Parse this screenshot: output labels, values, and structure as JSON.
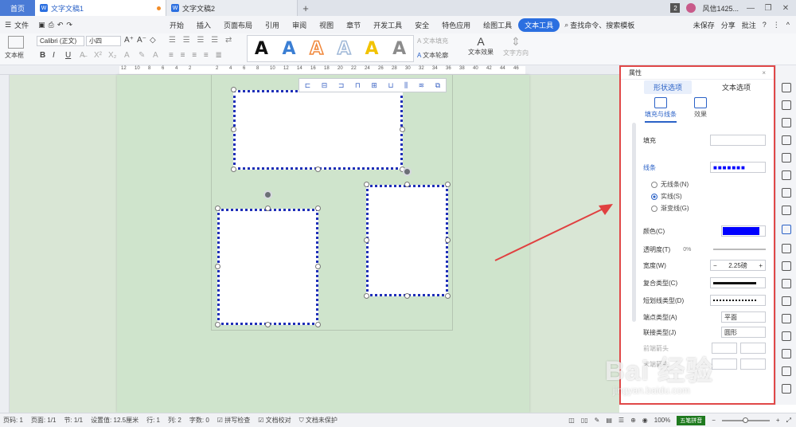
{
  "tabs": {
    "home": "首页",
    "doc1": "文字文稿1",
    "doc2": "文字文稿2",
    "plus": "+",
    "badge": "2",
    "user": "风信1425..."
  },
  "menu": {
    "file": "文件",
    "items": [
      "开始",
      "插入",
      "页面布局",
      "引用",
      "审阅",
      "视图",
      "章节",
      "开发工具",
      "安全",
      "特色应用",
      "绘图工具"
    ],
    "active": "文本工具",
    "search": "查找命令、搜索模板",
    "unsaved": "未保存",
    "share": "分享",
    "comment": "批注"
  },
  "ribbon": {
    "textbox": "文本框",
    "font_name": "Calibri (正文)",
    "font_size": "小四",
    "bold": "B",
    "italic": "I",
    "underline": "U",
    "style_letters": [
      "A",
      "A",
      "A",
      "A",
      "A",
      "A"
    ],
    "style_colors": [
      "#111111",
      "#3b7fd4",
      "#f0873a",
      "#9fb8d8",
      "#f2c300",
      "#8c8c8c"
    ],
    "text_fill": "文本填充",
    "text_outline": "文本轮廓",
    "text_effect": "文本效果",
    "text_direction": "文字方向"
  },
  "ruler": [
    "12",
    "10",
    "8",
    "6",
    "4",
    "2",
    "",
    "2",
    "4",
    "6",
    "8",
    "10",
    "12",
    "14",
    "16",
    "18",
    "20",
    "22",
    "24",
    "26",
    "28",
    "30",
    "32",
    "34",
    "36",
    "38",
    "40",
    "42",
    "44",
    "46",
    "48"
  ],
  "panel": {
    "title": "属性",
    "close": "×",
    "tab_shape": "形状选项",
    "tab_text": "文本选项",
    "sub_fill": "填充与线条",
    "sub_effect": "效果",
    "fill": "填充",
    "line": "线条",
    "no_line": "无线条(N)",
    "solid_line": "实线(S)",
    "gradient_line": "渐变线(G)",
    "color": "颜色(C)",
    "color_value": "#0000ff",
    "transparency": "透明度(T)",
    "transparency_value": "0%",
    "width": "宽度(W)",
    "width_value": "2.25磅",
    "compound": "复合类型(C)",
    "dash": "短划线类型(D)",
    "cap": "端点类型(A)",
    "cap_value": "平面",
    "join": "联接类型(J)",
    "join_value": "圆形",
    "arrow_front": "前端箭头",
    "arrow_end": "末端箭头"
  },
  "status": {
    "page": "页码: 1",
    "pages": "页面: 1/1",
    "section": "节: 1/1",
    "setting": "设置值: 12.5厘米",
    "row": "行: 1",
    "col": "列: 2",
    "words": "字数: 0",
    "spell": "拼写检查",
    "proof": "文档校对",
    "protect": "文档未保护",
    "zoom": "100%",
    "ime": "五笔拼音"
  },
  "watermark": {
    "main": "Bai 经验",
    "sub": "jingyan.baidu.com"
  }
}
